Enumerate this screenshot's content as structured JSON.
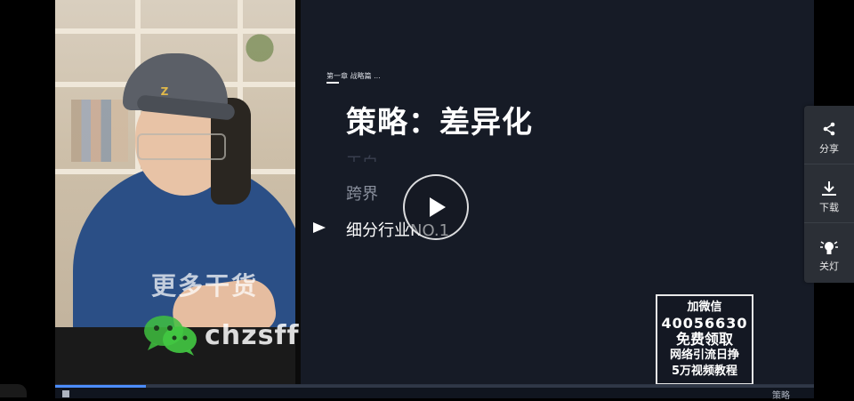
{
  "slide": {
    "chapter": "第一章 战略篇 ...",
    "title": "策略：差异化",
    "items": [
      "王白",
      "跨界",
      "细分行业NO.1"
    ]
  },
  "video": {
    "watermark": "更多干货",
    "wechat_id": "chzsff"
  },
  "promo": {
    "line1": "加微信",
    "line2": "40056630",
    "line3": "免费领取",
    "line4": "网络引流日挣",
    "line5": "5万视频教程"
  },
  "side_panel": {
    "share_label": "分享",
    "download_label": "下载",
    "lights_label": "关灯"
  },
  "controls": {
    "next_label": "策略",
    "progress": 0.12
  },
  "colors": {
    "slide_bg": "#161b26",
    "accent": "#4c8dff",
    "panel_bg": "#2b2f36"
  }
}
